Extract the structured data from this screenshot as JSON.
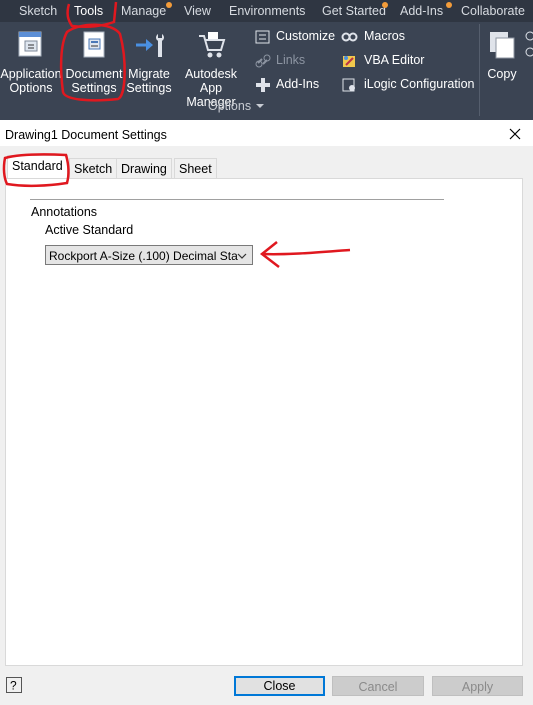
{
  "ribbon": {
    "tabs": [
      "Sketch",
      "Tools",
      "Manage",
      "View",
      "Environments",
      "Get Started",
      "Add-Ins",
      "Collaborate"
    ],
    "active_tab": "Tools",
    "big_buttons": [
      {
        "line1": "Application",
        "line2": "Options"
      },
      {
        "line1": "Document",
        "line2": "Settings"
      },
      {
        "line1": "Migrate",
        "line2": "Settings"
      },
      {
        "line1": "Autodesk",
        "line2": "App Manager"
      }
    ],
    "small_buttons": {
      "customize": "Customize",
      "links": "Links",
      "addins": "Add-Ins",
      "macros": "Macros",
      "vba": "VBA Editor",
      "ilogic": "iLogic Configuration"
    },
    "copy_label": "Copy",
    "panel_label": "Options"
  },
  "dialog": {
    "title": "Drawing1 Document Settings",
    "tabs": [
      "Standard",
      "Sketch",
      "Drawing",
      "Sheet"
    ],
    "active_tab": "Standard",
    "group_label": "Annotations",
    "active_standard_label": "Active Standard",
    "active_standard_value": "Rockport A-Size (.100) Decimal Sta",
    "buttons": {
      "close": "Close",
      "cancel": "Cancel",
      "apply": "Apply"
    },
    "help_glyph": "?"
  },
  "colors": {
    "ribbon_bg": "#3b4453",
    "annotation": "#e0181f",
    "focus": "#0078d7"
  }
}
